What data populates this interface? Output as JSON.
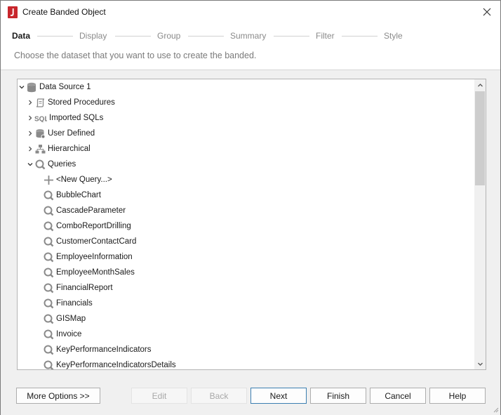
{
  "window": {
    "title": "Create Banded Object"
  },
  "steps": [
    "Data",
    "Display",
    "Group",
    "Summary",
    "Filter",
    "Style"
  ],
  "instruction": "Choose the dataset that you want to use to create the banded.",
  "tree": {
    "root": "Data Source 1",
    "folders": [
      "Stored Procedures",
      "Imported SQLs",
      "User Defined",
      "Hierarchical",
      "Queries"
    ],
    "new_query": "<New Query...>",
    "queries": [
      "BubbleChart",
      "CascadeParameter",
      "ComboReportDrilling",
      "CustomerContactCard",
      "EmployeeInformation",
      "EmployeeMonthSales",
      "FinancialReport",
      "Financials",
      "GISMap",
      "Invoice",
      "KeyPerformanceIndicators",
      "KeyPerformanceIndicatorsDetails"
    ]
  },
  "buttons": {
    "more_options": "More Options >>",
    "edit": "Edit",
    "back": "Back",
    "next": "Next",
    "finish": "Finish",
    "cancel": "Cancel",
    "help": "Help"
  },
  "colors": {
    "app_icon": "#c8262c",
    "selected_border": "#3c7fb1",
    "icon_gray": "#8a8a8a"
  },
  "icons": {
    "app": "report-app-icon",
    "close": "close-icon",
    "datasource": "database-icon",
    "stored_procedures": "scroll-icon",
    "imported_sqls": "sql-icon",
    "user_defined": "database-user-icon",
    "hierarchical": "hierarchy-icon",
    "query": "query-icon",
    "new_query": "plus-icon"
  }
}
